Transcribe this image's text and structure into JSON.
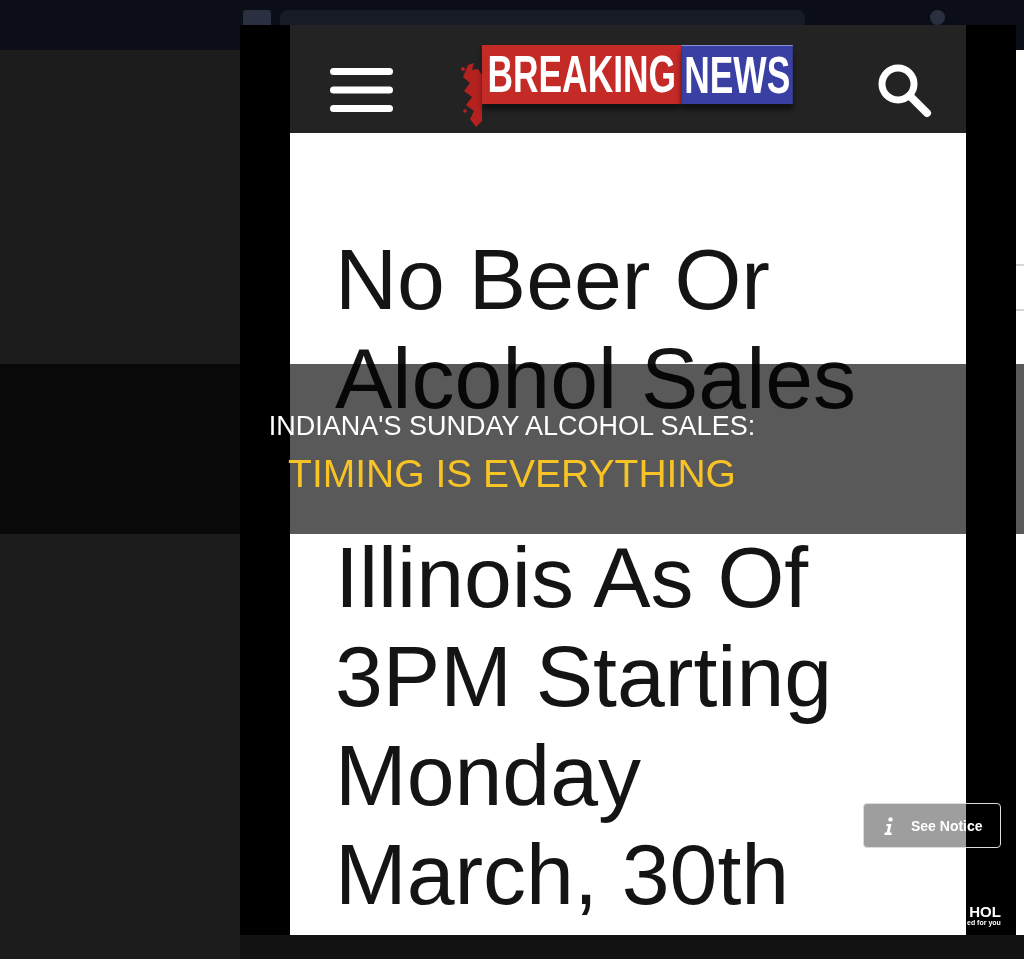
{
  "news_screenshot": {
    "header": {
      "brand_left": "BREAKING",
      "brand_right": "NEWS"
    },
    "headline_top": "No Beer Or\nAlcohol Sales",
    "headline_bottom": "Illinois As Of\n3PM Starting\nMonday\nMarch, 30th"
  },
  "title_banner": {
    "title": "INDIANA'S SUNDAY ALCOHOL SALES:",
    "subtitle": "TIMING IS EVERYTHING"
  },
  "notice_button": {
    "label": "See Notice"
  },
  "corner_logo": {
    "wordmark": "HOL",
    "tagline": "ed for you"
  }
}
